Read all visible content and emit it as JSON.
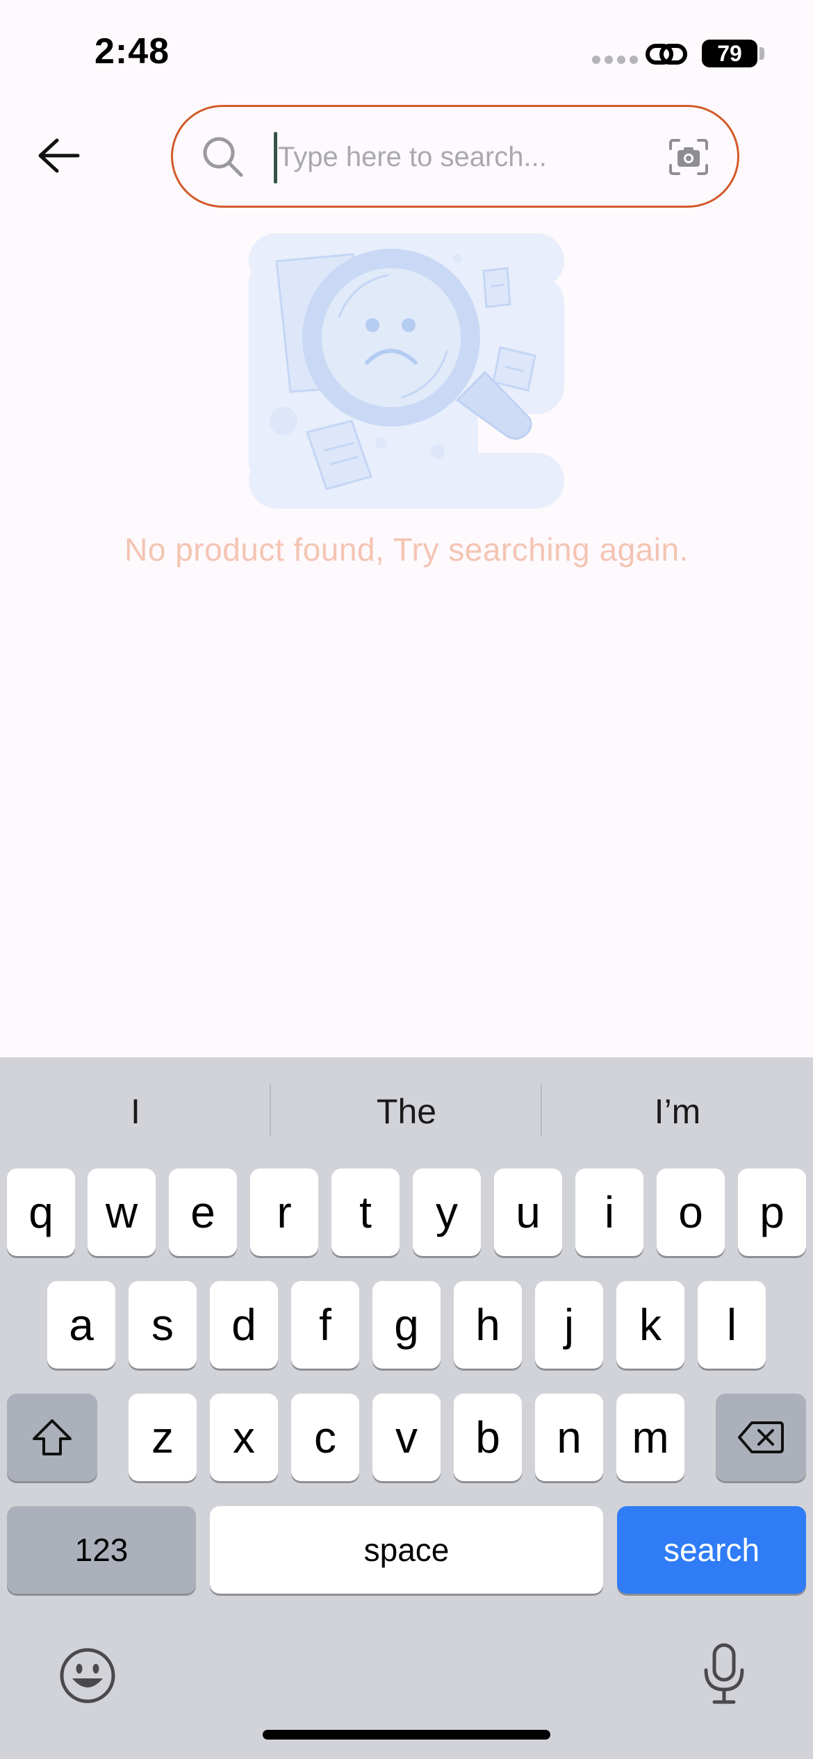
{
  "status_bar": {
    "time": "2:48",
    "battery": "79",
    "icons": [
      "signal-dots-icon",
      "link-icon",
      "battery-icon"
    ]
  },
  "header": {
    "back_icon": "arrow-left-icon",
    "search": {
      "value": "",
      "placeholder": "Type here to search...",
      "left_icon": "search-icon",
      "right_icon": "camera-icon"
    },
    "accent_color": "#d25a2a"
  },
  "empty_state": {
    "illustration": "sad-magnifier-documents-illustration",
    "message": "No product found, Try searching again.",
    "message_color": "#f4c4b3"
  },
  "keyboard": {
    "suggestions": [
      "I",
      "The",
      "I’m"
    ],
    "rows": [
      [
        "q",
        "w",
        "e",
        "r",
        "t",
        "y",
        "u",
        "i",
        "o",
        "p"
      ],
      [
        "a",
        "s",
        "d",
        "f",
        "g",
        "h",
        "j",
        "k",
        "l"
      ],
      [
        "z",
        "x",
        "c",
        "v",
        "b",
        "n",
        "m"
      ]
    ],
    "numbers_label": "123",
    "space_label": "space",
    "action_label": "search",
    "action_color": "#2f7cf6",
    "icons": [
      "shift-icon",
      "backspace-icon",
      "emoji-icon",
      "microphone-icon"
    ]
  }
}
